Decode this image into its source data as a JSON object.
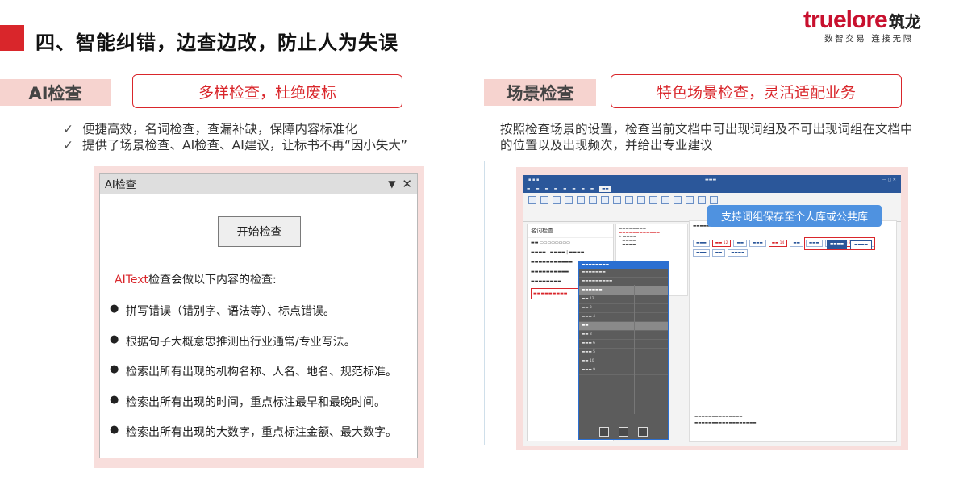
{
  "header": {
    "title": "四、智能纠错，边查边改，防止人为失误",
    "logo_brand": "truelore",
    "logo_cn": "筑龙",
    "logo_tagline": "数智交易 连接无限"
  },
  "left": {
    "tag": "AI检查",
    "highlight": "多样检查，杜绝废标",
    "bullets": [
      "便捷高效，名词检查，查漏补缺，保障内容标准化",
      "提供了场景检查、AI检查、AI建议，让标书不再“因小失大”"
    ],
    "panel": {
      "title": "AI检查",
      "start_button": "开始检查",
      "intro_brand_a": "AI",
      "intro_brand_b": "Text",
      "intro_rest": "检查会做以下内容的检查:",
      "items": [
        "拼写错误（错别字、语法等）、标点错误。",
        "根据句子大概意思推测出行业通常/专业写法。",
        "检索出所有出现的机构名称、人名、地名、规范标准。",
        "检索出所有出现的时间，重点标注最早和最晚时间。",
        "检索出所有出现的大数字，重点标注金额、最大数字。"
      ]
    }
  },
  "right": {
    "tag": "场景检查",
    "highlight": "特色场景检查，灵活适配业务",
    "description": "按照检查场景的设置，检查当前文档中可出现词组及不可出现词组在文档中的位置以及出现频次，并给出专业建议",
    "screenshot": {
      "tooltip": "支持词组保存至个人库或公共库",
      "left_title": "名词检查"
    }
  },
  "colors": {
    "accent": "#d9262b",
    "tag_bg": "#f6d3cf",
    "word_blue": "#2b579a",
    "tooltip": "#4f92e0"
  }
}
